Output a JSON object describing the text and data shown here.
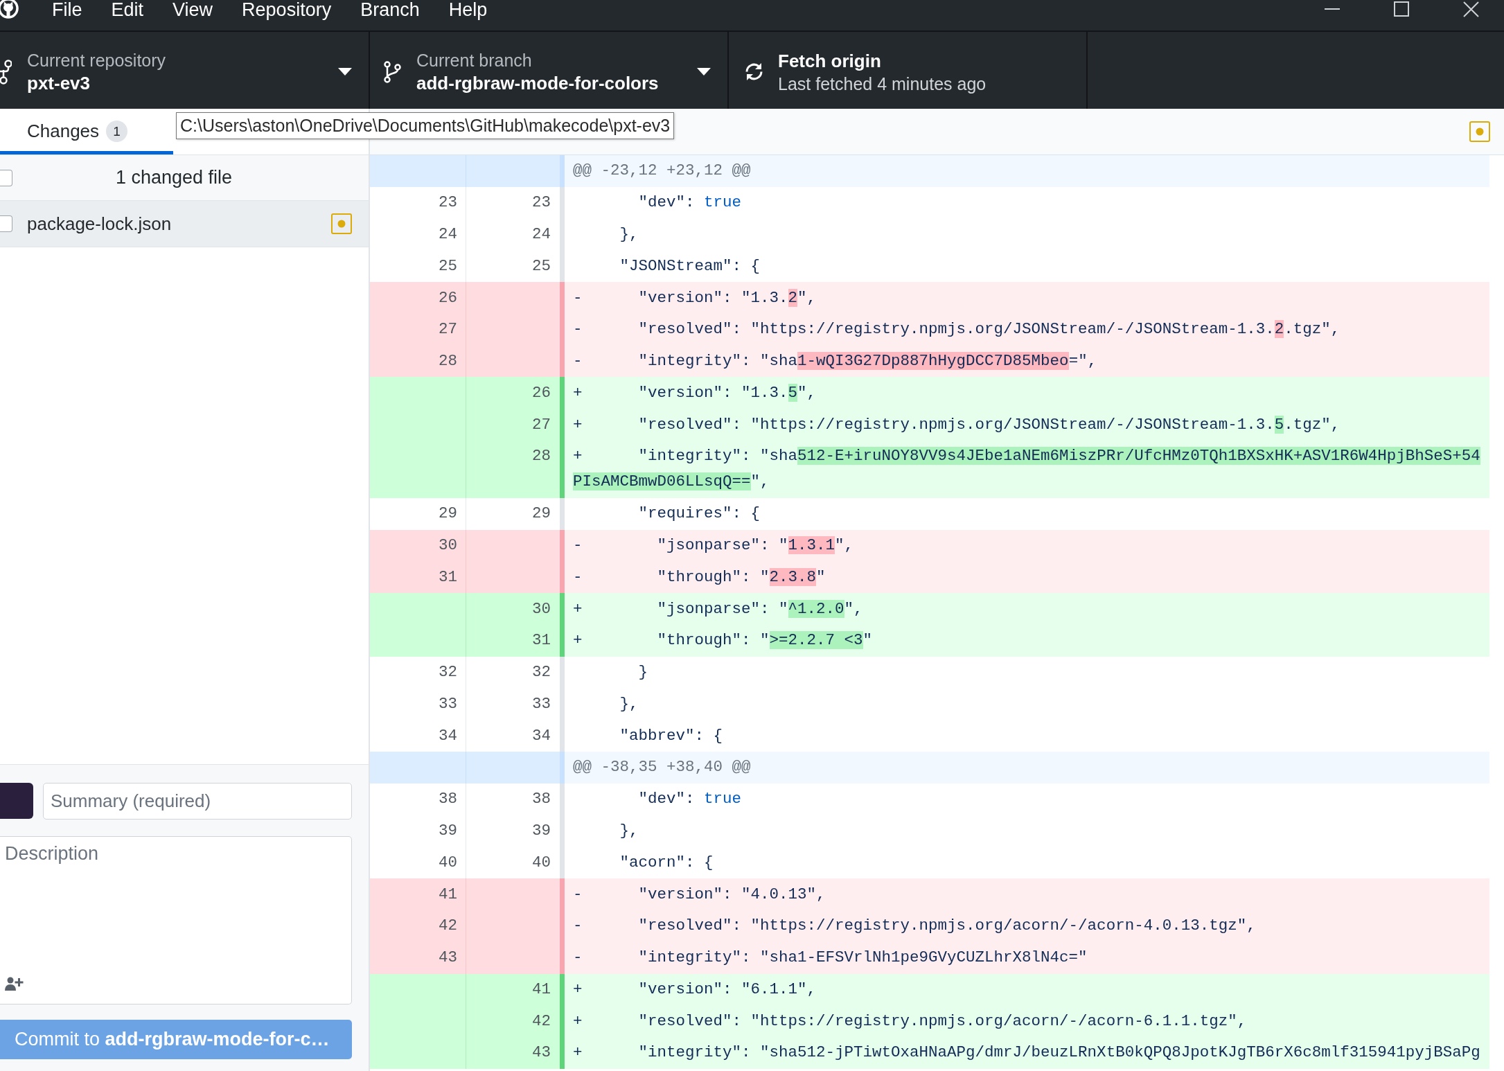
{
  "menu_bar": {
    "items": [
      "File",
      "Edit",
      "View",
      "Repository",
      "Branch",
      "Help"
    ]
  },
  "toolbar": {
    "repository": {
      "label": "Current repository",
      "value": "pxt-ev3"
    },
    "branch": {
      "label": "Current branch",
      "value": "add-rgbraw-mode-for-colors"
    },
    "fetch": {
      "title": "Fetch origin",
      "subtitle": "Last fetched 4 minutes ago"
    }
  },
  "tabs": [
    {
      "label": "Changes",
      "count": "1",
      "selected": true
    }
  ],
  "tooltip": {
    "text": "C:\\Users\\aston\\OneDrive\\Documents\\GitHub\\makecode\\pxt-ev3"
  },
  "changes": {
    "header": {
      "label": "1 changed file",
      "checked": false
    },
    "files": [
      {
        "name": "package-lock.json",
        "modified": true,
        "checked": false,
        "selected": true
      }
    ]
  },
  "commit": {
    "summary": {
      "placeholder": "Summary (required)"
    },
    "description": {
      "placeholder": "Description"
    },
    "button": {
      "label": "Commit to **add-rgbraw-mode-for-c…**"
    }
  },
  "diff": {
    "modified": true,
    "lines": [
      {
        "kind": "hunk",
        "text": "@@ -23,12 +23,12 @@"
      },
      {
        "kind": "context",
        "old": "23",
        "new": "23",
        "segments": [
          {
            "kind": "plain",
            "text": "       \"dev\": "
          },
          {
            "kind": "keyword",
            "text": "true"
          }
        ]
      },
      {
        "kind": "context",
        "old": "24",
        "new": "24",
        "segments": [
          {
            "kind": "plain",
            "text": "     },"
          }
        ]
      },
      {
        "kind": "context",
        "old": "25",
        "new": "25",
        "segments": [
          {
            "kind": "plain",
            "text": "     \"JSONStream\": {"
          }
        ]
      },
      {
        "kind": "deleted",
        "old": "26",
        "segments": [
          {
            "kind": "plain",
            "text": "-      \"version\": \"1.3."
          },
          {
            "kind": "changed",
            "text": "2"
          },
          {
            "kind": "plain",
            "text": "\","
          }
        ]
      },
      {
        "kind": "deleted",
        "old": "27",
        "segments": [
          {
            "kind": "plain",
            "text": "-      \"resolved\": \"https://registry.npmjs.org/JSONStream/-/JSONStream-1.3."
          },
          {
            "kind": "changed",
            "text": "2"
          },
          {
            "kind": "plain",
            "text": ".tgz\","
          }
        ]
      },
      {
        "kind": "deleted",
        "old": "28",
        "segments": [
          {
            "kind": "plain",
            "text": "-      \"integrity\": \"sha"
          },
          {
            "kind": "changed",
            "text": "1-wQI3G27Dp887hHygDCC7D85Mbeo"
          },
          {
            "kind": "plain",
            "text": "=\","
          }
        ]
      },
      {
        "kind": "added",
        "new": "26",
        "segments": [
          {
            "kind": "plain",
            "text": "+      \"version\": \"1.3."
          },
          {
            "kind": "changed",
            "text": "5"
          },
          {
            "kind": "plain",
            "text": "\","
          }
        ]
      },
      {
        "kind": "added",
        "new": "27",
        "segments": [
          {
            "kind": "plain",
            "text": "+      \"resolved\": \"https://registry.npmjs.org/JSONStream/-/JSONStream-1.3."
          },
          {
            "kind": "changed",
            "text": "5"
          },
          {
            "kind": "plain",
            "text": ".tgz\","
          }
        ]
      },
      {
        "kind": "added",
        "new": "28",
        "segments": [
          {
            "kind": "plain",
            "text": "+      \"integrity\": \"sha"
          },
          {
            "kind": "changed",
            "text": "512-E+iruNOY8VV9s4JEbe1aNEm6MiszPRr/UfcHMz0TQh1BXSxHK+ASV1R6W4HpjBhSeS+54PIsAMCBmwD06LLsqQ=="
          },
          {
            "kind": "plain",
            "text": "\","
          }
        ]
      },
      {
        "kind": "context",
        "old": "29",
        "new": "29",
        "segments": [
          {
            "kind": "plain",
            "text": "       \"requires\": {"
          }
        ]
      },
      {
        "kind": "deleted",
        "old": "30",
        "segments": [
          {
            "kind": "plain",
            "text": "-        \"jsonparse\": \""
          },
          {
            "kind": "changed",
            "text": "1.3.1"
          },
          {
            "kind": "plain",
            "text": "\","
          }
        ]
      },
      {
        "kind": "deleted",
        "old": "31",
        "segments": [
          {
            "kind": "plain",
            "text": "-        \"through\": \""
          },
          {
            "kind": "changed",
            "text": "2.3.8"
          },
          {
            "kind": "plain",
            "text": "\""
          }
        ]
      },
      {
        "kind": "added",
        "new": "30",
        "segments": [
          {
            "kind": "plain",
            "text": "+        \"jsonparse\": \""
          },
          {
            "kind": "changed",
            "text": "^1.2.0"
          },
          {
            "kind": "plain",
            "text": "\","
          }
        ]
      },
      {
        "kind": "added",
        "new": "31",
        "segments": [
          {
            "kind": "plain",
            "text": "+        \"through\": \""
          },
          {
            "kind": "changed",
            "text": ">=2.2.7 <3"
          },
          {
            "kind": "plain",
            "text": "\""
          }
        ]
      },
      {
        "kind": "context",
        "old": "32",
        "new": "32",
        "segments": [
          {
            "kind": "plain",
            "text": "       }"
          }
        ]
      },
      {
        "kind": "context",
        "old": "33",
        "new": "33",
        "segments": [
          {
            "kind": "plain",
            "text": "     },"
          }
        ]
      },
      {
        "kind": "context",
        "old": "34",
        "new": "34",
        "segments": [
          {
            "kind": "plain",
            "text": "     \"abbrev\": {"
          }
        ]
      },
      {
        "kind": "hunk",
        "text": "@@ -38,35 +38,40 @@"
      },
      {
        "kind": "context",
        "old": "38",
        "new": "38",
        "segments": [
          {
            "kind": "plain",
            "text": "       \"dev\": "
          },
          {
            "kind": "keyword",
            "text": "true"
          }
        ]
      },
      {
        "kind": "context",
        "old": "39",
        "new": "39",
        "segments": [
          {
            "kind": "plain",
            "text": "     },"
          }
        ]
      },
      {
        "kind": "context",
        "old": "40",
        "new": "40",
        "segments": [
          {
            "kind": "plain",
            "text": "     \"acorn\": {"
          }
        ]
      },
      {
        "kind": "deleted",
        "old": "41",
        "segments": [
          {
            "kind": "plain",
            "text": "-      \"version\": \"4.0.13\","
          }
        ]
      },
      {
        "kind": "deleted",
        "old": "42",
        "segments": [
          {
            "kind": "plain",
            "text": "-      \"resolved\": \"https://registry.npmjs.org/acorn/-/acorn-4.0.13.tgz\","
          }
        ]
      },
      {
        "kind": "deleted",
        "old": "43",
        "segments": [
          {
            "kind": "plain",
            "text": "-      \"integrity\": \"sha1-EFSVrlNh1pe9GVyCUZLhrX8lN4c=\""
          }
        ]
      },
      {
        "kind": "added",
        "new": "41",
        "segments": [
          {
            "kind": "plain",
            "text": "+      \"version\": \"6.1.1\","
          }
        ]
      },
      {
        "kind": "added",
        "new": "42",
        "segments": [
          {
            "kind": "plain",
            "text": "+      \"resolved\": \"https://registry.npmjs.org/acorn/-/acorn-6.1.1.tgz\","
          }
        ]
      },
      {
        "kind": "added",
        "new": "43",
        "segments": [
          {
            "kind": "plain",
            "text": "+      \"integrity\": \"sha512-jPTiwtOxaHNaAPg/dmrJ/beuzLRnXtB0kQPQ8JpotKJgTB6rX6c8mlf315941pyjBSaPg"
          }
        ]
      }
    ]
  }
}
